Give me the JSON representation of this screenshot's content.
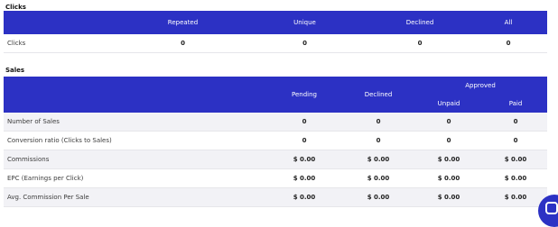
{
  "clicks": {
    "title": "Clicks",
    "columns": [
      "",
      "Repeated",
      "Unique",
      "Declined",
      "All"
    ],
    "row": {
      "label": "Clicks",
      "values": [
        "0",
        "0",
        "0",
        "0"
      ]
    }
  },
  "sales": {
    "title": "Sales",
    "header": {
      "pending": "Pending",
      "declined": "Declined",
      "approved": "Approved",
      "unpaid": "Unpaid",
      "paid": "Paid"
    },
    "rows": [
      {
        "label": "Number of Sales",
        "values": [
          "0",
          "0",
          "0",
          "0"
        ]
      },
      {
        "label": "Conversion ratio (Clicks to Sales)",
        "values": [
          "0",
          "0",
          "0",
          "0"
        ]
      },
      {
        "label": "Commissions",
        "values": [
          "$ 0.00",
          "$ 0.00",
          "$ 0.00",
          "$ 0.00"
        ]
      },
      {
        "label": "EPC (Earnings per Click)",
        "values": [
          "$ 0.00",
          "$ 0.00",
          "$ 0.00",
          "$ 0.00"
        ]
      },
      {
        "label": "Avg. Commission Per Sale",
        "values": [
          "$ 0.00",
          "$ 0.00",
          "$ 0.00",
          "$ 0.00"
        ]
      }
    ]
  },
  "colors": {
    "header_bg": "#2c31c4",
    "row_shade": "#f2f2f6"
  },
  "icons": {
    "chat_widget": "chat-icon"
  }
}
